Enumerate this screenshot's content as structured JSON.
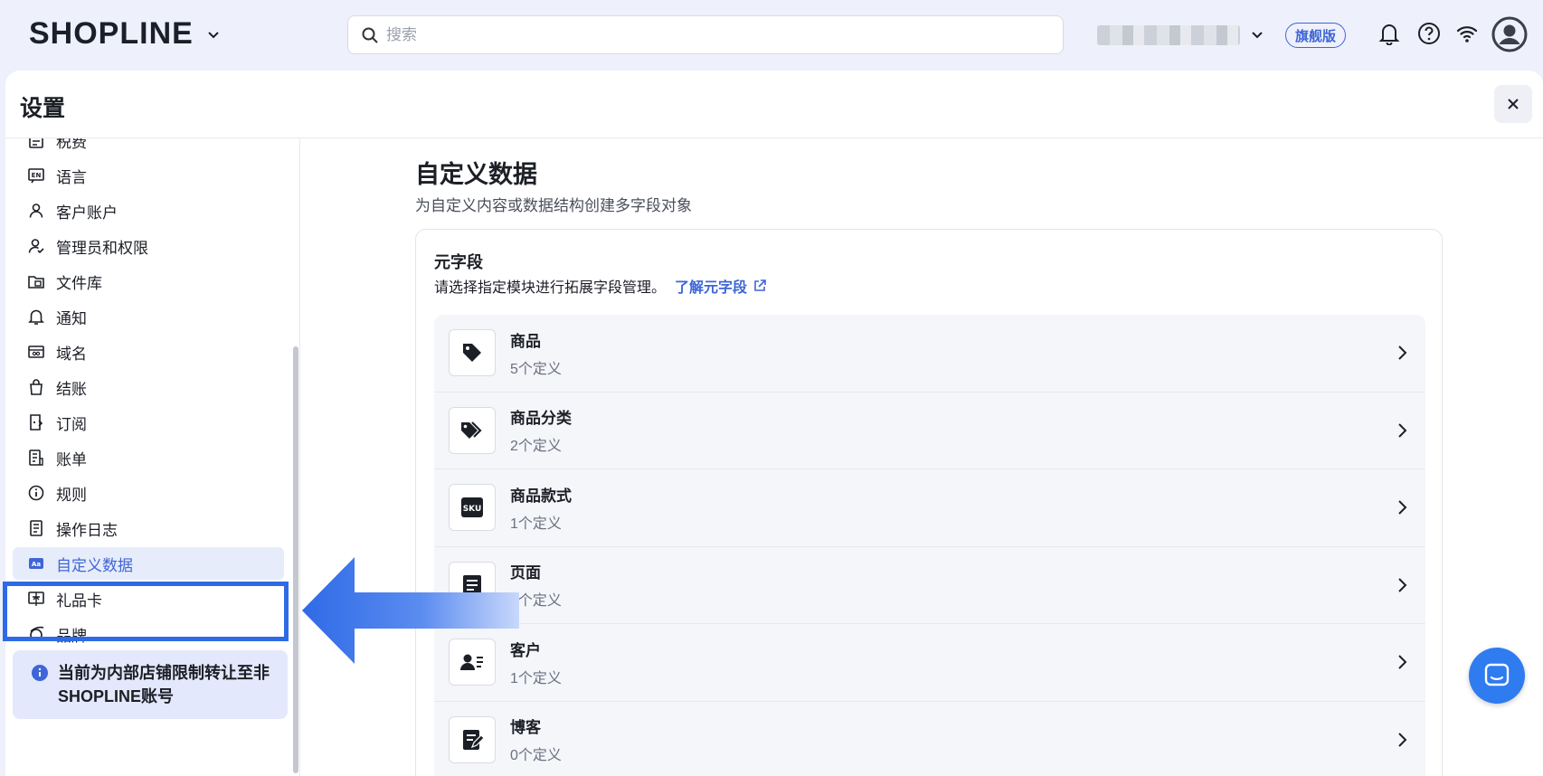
{
  "topbar": {
    "brand": "SHOPLINE",
    "search_placeholder": "搜索",
    "plan_badge": "旗舰版"
  },
  "panel": {
    "title": "设置"
  },
  "sidebar": {
    "items": [
      {
        "label": "税费",
        "icon": "tax-icon"
      },
      {
        "label": "语言",
        "icon": "language-icon"
      },
      {
        "label": "客户账户",
        "icon": "person-icon"
      },
      {
        "label": "管理员和权限",
        "icon": "admin-icon"
      },
      {
        "label": "文件库",
        "icon": "folder-icon"
      },
      {
        "label": "通知",
        "icon": "bell-icon"
      },
      {
        "label": "域名",
        "icon": "domain-icon"
      },
      {
        "label": "结账",
        "icon": "bag-icon"
      },
      {
        "label": "订阅",
        "icon": "subscription-icon"
      },
      {
        "label": "账单",
        "icon": "bill-icon"
      },
      {
        "label": "规则",
        "icon": "info-icon"
      },
      {
        "label": "操作日志",
        "icon": "log-icon"
      },
      {
        "label": "自定义数据",
        "icon": "custom-data-icon",
        "active": true
      },
      {
        "label": "礼品卡",
        "icon": "gift-card-icon"
      },
      {
        "label": "品牌",
        "icon": "brand-icon"
      }
    ],
    "notice": "当前为内部店铺限制转让至非SHOPLINE账号"
  },
  "main": {
    "title": "自定义数据",
    "subtitle": "为自定义内容或数据结构创建多字段对象",
    "card": {
      "title": "元字段",
      "description": "请选择指定模块进行拓展字段管理。",
      "link": "了解元字段",
      "rows": [
        {
          "name": "商品",
          "count": "5个定义",
          "icon": "tag-icon"
        },
        {
          "name": "商品分类",
          "count": "2个定义",
          "icon": "tags-icon"
        },
        {
          "name": "商品款式",
          "count": "1个定义",
          "icon": "sku-icon",
          "icon_text": "SKU"
        },
        {
          "name": "页面",
          "count": "0个定义",
          "icon": "page-icon"
        },
        {
          "name": "客户",
          "count": "1个定义",
          "icon": "customer-icon"
        },
        {
          "name": "博客",
          "count": "0个定义",
          "icon": "blog-icon"
        }
      ]
    }
  },
  "colors": {
    "accent": "#3f66d6",
    "highlight": "#2f6ae6",
    "topbar_bg": "#eef0fb"
  }
}
